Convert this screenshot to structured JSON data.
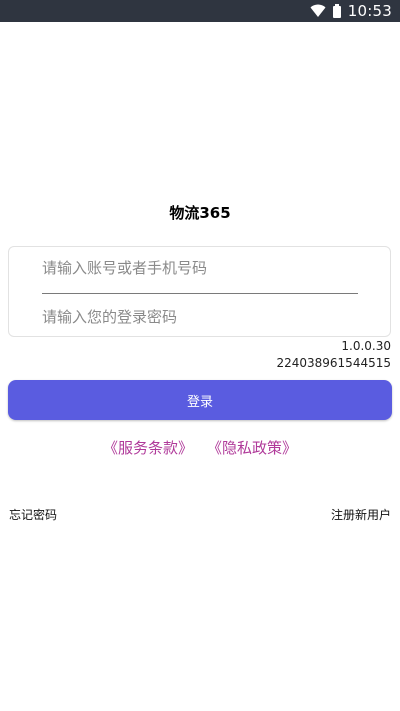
{
  "status_bar": {
    "time": "10:53",
    "icons": [
      "wifi-icon",
      "battery-icon"
    ],
    "background": "#2f3540"
  },
  "app": {
    "title": "物流365"
  },
  "form": {
    "account_placeholder": "请输入账号或者手机号码",
    "password_placeholder": "请输入您的登录密码",
    "account_value": "",
    "password_value": ""
  },
  "info": {
    "version": "1.0.0.30",
    "device_id": "224038961544515"
  },
  "actions": {
    "login_label": "登录",
    "terms_label": "《服务条款》",
    "privacy_label": "《隐私政策》",
    "forgot_password_label": "忘记密码",
    "register_label": "注册新用户"
  },
  "colors": {
    "primary": "#5a5ce0",
    "link": "#b03a9a"
  }
}
